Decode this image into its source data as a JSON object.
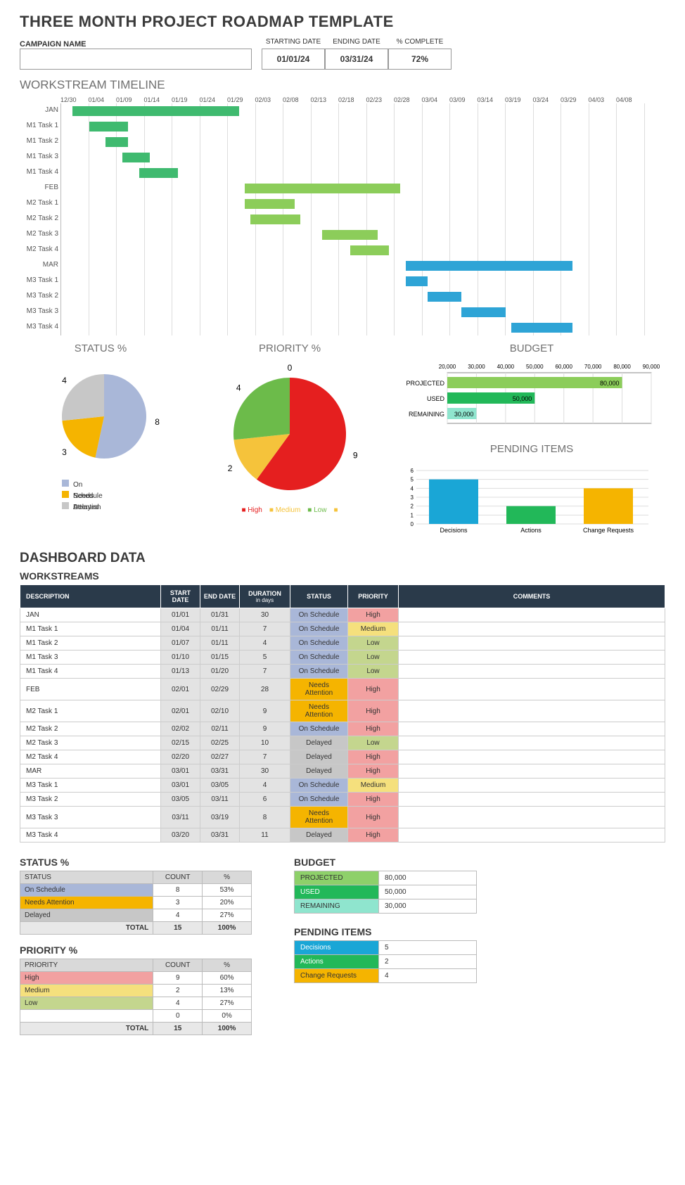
{
  "title": "THREE MONTH PROJECT ROADMAP TEMPLATE",
  "header": {
    "campaign_label": "CAMPAIGN NAME",
    "starting_date_label": "STARTING DATE",
    "ending_date_label": "ENDING DATE",
    "complete_label": "% COMPLETE",
    "starting_date": "01/01/24",
    "ending_date": "03/31/24",
    "complete": "72%"
  },
  "timeline_title": "WORKSTREAM TIMELINE",
  "timeline_dates": [
    "12/30",
    "01/04",
    "01/09",
    "01/14",
    "01/19",
    "01/24",
    "01/29",
    "02/03",
    "02/08",
    "02/13",
    "02/18",
    "02/23",
    "02/28",
    "03/04",
    "03/09",
    "03/14",
    "03/19",
    "03/24",
    "03/29",
    "04/03",
    "04/08"
  ],
  "status_title": "STATUS %",
  "priority_title": "PRIORITY %",
  "budget_title": "BUDGET",
  "pending_title": "PENDING ITEMS",
  "status_legend": [
    "On Schedule",
    "Needs Attention",
    "Delayed"
  ],
  "priority_legend": [
    "High",
    "Medium",
    "Low"
  ],
  "dashboard_title": "DASHBOARD DATA",
  "workstreams_title": "WORKSTREAMS",
  "ws_headers": {
    "description": "DESCRIPTION",
    "start": "START DATE",
    "end": "END DATE",
    "duration": "DURATION",
    "duration_sub": "in days",
    "status": "STATUS",
    "priority": "PRIORITY",
    "comments": "COMMENTS"
  },
  "status_section_title": "STATUS %",
  "status_table_headers": {
    "status": "STATUS",
    "count": "COUNT",
    "pct": "%"
  },
  "status_rows": [
    {
      "label": "On Schedule",
      "count": "8",
      "pct": "53%",
      "cls": "st-onschedule"
    },
    {
      "label": "Needs Attention",
      "count": "3",
      "pct": "20%",
      "cls": "st-needs"
    },
    {
      "label": "Delayed",
      "count": "4",
      "pct": "27%",
      "cls": "st-delayed"
    }
  ],
  "status_total_label": "TOTAL",
  "status_total_count": "15",
  "status_total_pct": "100%",
  "priority_section_title": "PRIORITY %",
  "priority_table_headers": {
    "priority": "PRIORITY",
    "count": "COUNT",
    "pct": "%"
  },
  "priority_rows": [
    {
      "label": "High",
      "count": "9",
      "pct": "60%",
      "cls": "pr-high"
    },
    {
      "label": "Medium",
      "count": "2",
      "pct": "13%",
      "cls": "pr-medium"
    },
    {
      "label": "Low",
      "count": "4",
      "pct": "27%",
      "cls": "pr-low"
    },
    {
      "label": "",
      "count": "0",
      "pct": "0%",
      "cls": ""
    }
  ],
  "priority_total_label": "TOTAL",
  "priority_total_count": "15",
  "priority_total_pct": "100%",
  "budget_section_title": "BUDGET",
  "budget_rows": [
    {
      "label": "PROJECTED",
      "value": "80,000",
      "cls": "bg-proj"
    },
    {
      "label": "USED",
      "value": "50,000",
      "cls": "bg-used"
    },
    {
      "label": "REMAINING",
      "value": "30,000",
      "cls": "bg-rem"
    }
  ],
  "pending_section_title": "PENDING ITEMS",
  "pending_rows": [
    {
      "label": "Decisions",
      "value": "5",
      "cls": "bg-dec"
    },
    {
      "label": "Actions",
      "value": "2",
      "cls": "bg-act"
    },
    {
      "label": "Change Requests",
      "value": "4",
      "cls": "bg-chg"
    }
  ],
  "chart_data": [
    {
      "type": "gantt",
      "name": "Workstream Timeline",
      "rows": [
        {
          "label": "JAN",
          "start": "01/01",
          "end": "01/31",
          "color": "#3fba6f"
        },
        {
          "label": "M1 Task 1",
          "start": "01/04",
          "end": "01/11",
          "color": "#3fba6f"
        },
        {
          "label": "M1 Task 2",
          "start": "01/07",
          "end": "01/11",
          "color": "#3fba6f"
        },
        {
          "label": "M1 Task 3",
          "start": "01/10",
          "end": "01/15",
          "color": "#3fba6f"
        },
        {
          "label": "M1 Task 4",
          "start": "01/13",
          "end": "01/20",
          "color": "#3fba6f"
        },
        {
          "label": "FEB",
          "start": "02/01",
          "end": "02/29",
          "color": "#8ccd5a"
        },
        {
          "label": "M2 Task 1",
          "start": "02/01",
          "end": "02/10",
          "color": "#8ccd5a"
        },
        {
          "label": "M2 Task 2",
          "start": "02/02",
          "end": "02/11",
          "color": "#8ccd5a"
        },
        {
          "label": "M2 Task 3",
          "start": "02/15",
          "end": "02/25",
          "color": "#8ccd5a"
        },
        {
          "label": "M2 Task 4",
          "start": "02/20",
          "end": "02/27",
          "color": "#8ccd5a"
        },
        {
          "label": "MAR",
          "start": "03/01",
          "end": "03/31",
          "color": "#2ea4d6"
        },
        {
          "label": "M3 Task 1",
          "start": "03/01",
          "end": "03/05",
          "color": "#2ea4d6"
        },
        {
          "label": "M3 Task 2",
          "start": "03/05",
          "end": "03/11",
          "color": "#2ea4d6"
        },
        {
          "label": "M3 Task 3",
          "start": "03/11",
          "end": "03/19",
          "color": "#2ea4d6"
        },
        {
          "label": "M3 Task 4",
          "start": "03/20",
          "end": "03/31",
          "color": "#2ea4d6"
        }
      ]
    },
    {
      "type": "pie",
      "title": "STATUS %",
      "slices": [
        {
          "label": "On Schedule",
          "value": 8,
          "color": "#a9b7d8"
        },
        {
          "label": "Needs Attention",
          "value": 3,
          "color": "#f5b400"
        },
        {
          "label": "Delayed",
          "value": 4,
          "color": "#c7c7c7"
        }
      ],
      "data_labels": [
        "8",
        "3",
        "4"
      ]
    },
    {
      "type": "pie",
      "title": "PRIORITY %",
      "slices": [
        {
          "label": "High",
          "value": 9,
          "color": "#e51f1f"
        },
        {
          "label": "Medium",
          "value": 2,
          "color": "#f5c33b"
        },
        {
          "label": "Low",
          "value": 4,
          "color": "#6cbb4a"
        },
        {
          "label": "",
          "value": 0,
          "color": "#f5c33b"
        }
      ],
      "data_labels": [
        "9",
        "2",
        "4",
        "0"
      ]
    },
    {
      "type": "bar",
      "title": "BUDGET",
      "orientation": "horizontal",
      "categories": [
        "PROJECTED",
        "USED",
        "REMAINING"
      ],
      "values": [
        80000,
        50000,
        30000
      ],
      "data_labels": [
        "80,000",
        "50,000",
        "30,000"
      ],
      "colors": [
        "#8ccd5a",
        "#22b859",
        "#8fe5ce"
      ],
      "xlim": [
        20000,
        90000
      ],
      "xticks": [
        "20,000",
        "30,000",
        "40,000",
        "50,000",
        "60,000",
        "70,000",
        "80,000",
        "90,000"
      ]
    },
    {
      "type": "bar",
      "title": "PENDING ITEMS",
      "orientation": "vertical",
      "categories": [
        "Decisions",
        "Actions",
        "Change Requests"
      ],
      "values": [
        5,
        2,
        4
      ],
      "colors": [
        "#1aa6d6",
        "#22b859",
        "#f5b400"
      ],
      "ylim": [
        0,
        6
      ],
      "yticks": [
        "0",
        "1",
        "2",
        "3",
        "4",
        "5",
        "6"
      ]
    }
  ],
  "ws_rows": [
    {
      "desc": "JAN",
      "start": "01/01",
      "end": "01/31",
      "dur": "30",
      "status": "On Schedule",
      "st_cls": "st-onschedule",
      "priority": "High",
      "pr_cls": "pr-high"
    },
    {
      "desc": "M1 Task 1",
      "start": "01/04",
      "end": "01/11",
      "dur": "7",
      "status": "On Schedule",
      "st_cls": "st-onschedule",
      "priority": "Medium",
      "pr_cls": "pr-medium"
    },
    {
      "desc": "M1 Task 2",
      "start": "01/07",
      "end": "01/11",
      "dur": "4",
      "status": "On Schedule",
      "st_cls": "st-onschedule",
      "priority": "Low",
      "pr_cls": "pr-low"
    },
    {
      "desc": "M1 Task 3",
      "start": "01/10",
      "end": "01/15",
      "dur": "5",
      "status": "On Schedule",
      "st_cls": "st-onschedule",
      "priority": "Low",
      "pr_cls": "pr-low"
    },
    {
      "desc": "M1 Task 4",
      "start": "01/13",
      "end": "01/20",
      "dur": "7",
      "status": "On Schedule",
      "st_cls": "st-onschedule",
      "priority": "Low",
      "pr_cls": "pr-low"
    },
    {
      "desc": "FEB",
      "start": "02/01",
      "end": "02/29",
      "dur": "28",
      "status": "Needs Attention",
      "st_cls": "st-needs",
      "priority": "High",
      "pr_cls": "pr-high"
    },
    {
      "desc": "M2 Task 1",
      "start": "02/01",
      "end": "02/10",
      "dur": "9",
      "status": "Needs Attention",
      "st_cls": "st-needs",
      "priority": "High",
      "pr_cls": "pr-high"
    },
    {
      "desc": "M2 Task 2",
      "start": "02/02",
      "end": "02/11",
      "dur": "9",
      "status": "On Schedule",
      "st_cls": "st-onschedule",
      "priority": "High",
      "pr_cls": "pr-high"
    },
    {
      "desc": "M2 Task 3",
      "start": "02/15",
      "end": "02/25",
      "dur": "10",
      "status": "Delayed",
      "st_cls": "st-delayed",
      "priority": "Low",
      "pr_cls": "pr-low"
    },
    {
      "desc": "M2 Task 4",
      "start": "02/20",
      "end": "02/27",
      "dur": "7",
      "status": "Delayed",
      "st_cls": "st-delayed",
      "priority": "High",
      "pr_cls": "pr-high"
    },
    {
      "desc": "MAR",
      "start": "03/01",
      "end": "03/31",
      "dur": "30",
      "status": "Delayed",
      "st_cls": "st-delayed",
      "priority": "High",
      "pr_cls": "pr-high"
    },
    {
      "desc": "M3 Task 1",
      "start": "03/01",
      "end": "03/05",
      "dur": "4",
      "status": "On Schedule",
      "st_cls": "st-onschedule",
      "priority": "Medium",
      "pr_cls": "pr-medium"
    },
    {
      "desc": "M3 Task 2",
      "start": "03/05",
      "end": "03/11",
      "dur": "6",
      "status": "On Schedule",
      "st_cls": "st-onschedule",
      "priority": "High",
      "pr_cls": "pr-high"
    },
    {
      "desc": "M3 Task 3",
      "start": "03/11",
      "end": "03/19",
      "dur": "8",
      "status": "Needs Attention",
      "st_cls": "st-needs",
      "priority": "High",
      "pr_cls": "pr-high"
    },
    {
      "desc": "M3 Task 4",
      "start": "03/20",
      "end": "03/31",
      "dur": "11",
      "status": "Delayed",
      "st_cls": "st-delayed",
      "priority": "High",
      "pr_cls": "pr-high"
    }
  ]
}
